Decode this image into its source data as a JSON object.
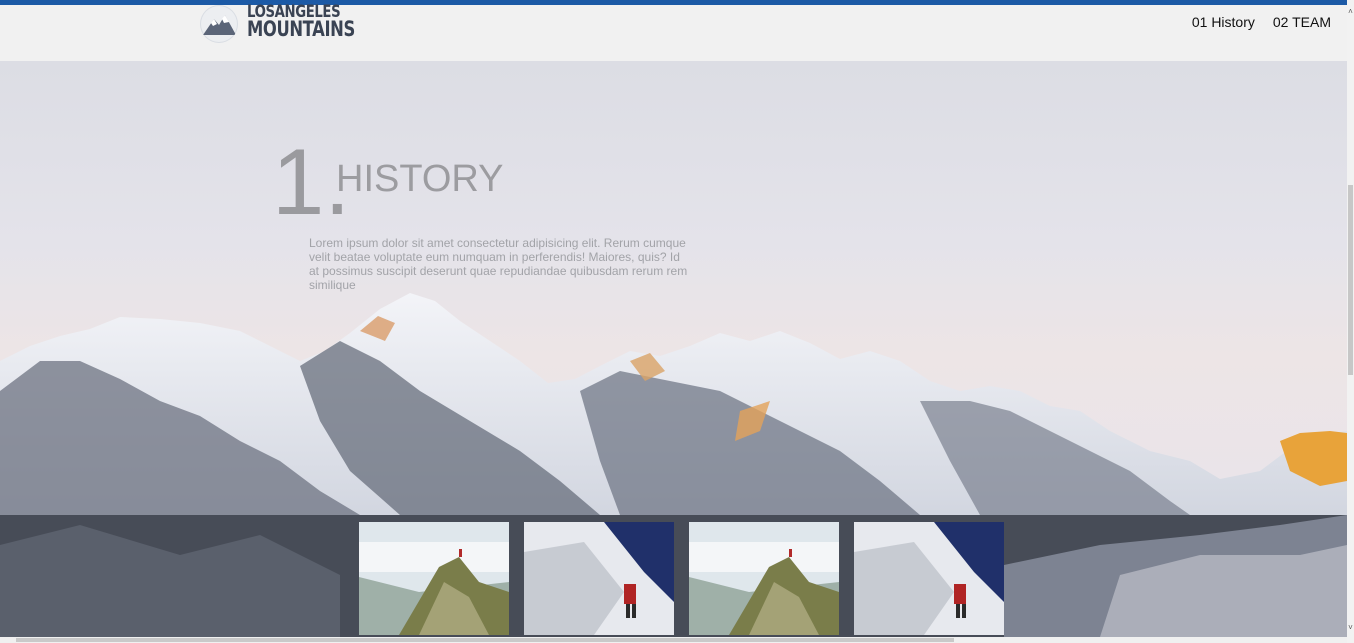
{
  "header": {
    "logo_line1": "LOSANGELES",
    "logo_line2": "MOUNTAINS",
    "nav": [
      {
        "label": "01 History"
      },
      {
        "label": "02 TEAM"
      }
    ]
  },
  "hero": {
    "number": "1.",
    "title": "HISTORY",
    "text": "Lorem ipsum dolor sit amet consectetur adipisicing elit. Rerum cumque velit beatae voluptate eum numquam in perferendis! Maiores, quis? Id at possimus suscipit deserunt quae repudiandae quibusdam rerum rem similique"
  },
  "gallery": {
    "items": [
      {
        "icon": "climber-on-peak-photo"
      },
      {
        "icon": "climber-on-snow-photo"
      },
      {
        "icon": "climber-on-peak-photo"
      },
      {
        "icon": "climber-on-snow-photo"
      }
    ]
  },
  "colors": {
    "top_stripe": "#1c5aa6",
    "header_bg": "#f1f1f1",
    "title_gray": "#9c9ca0"
  }
}
